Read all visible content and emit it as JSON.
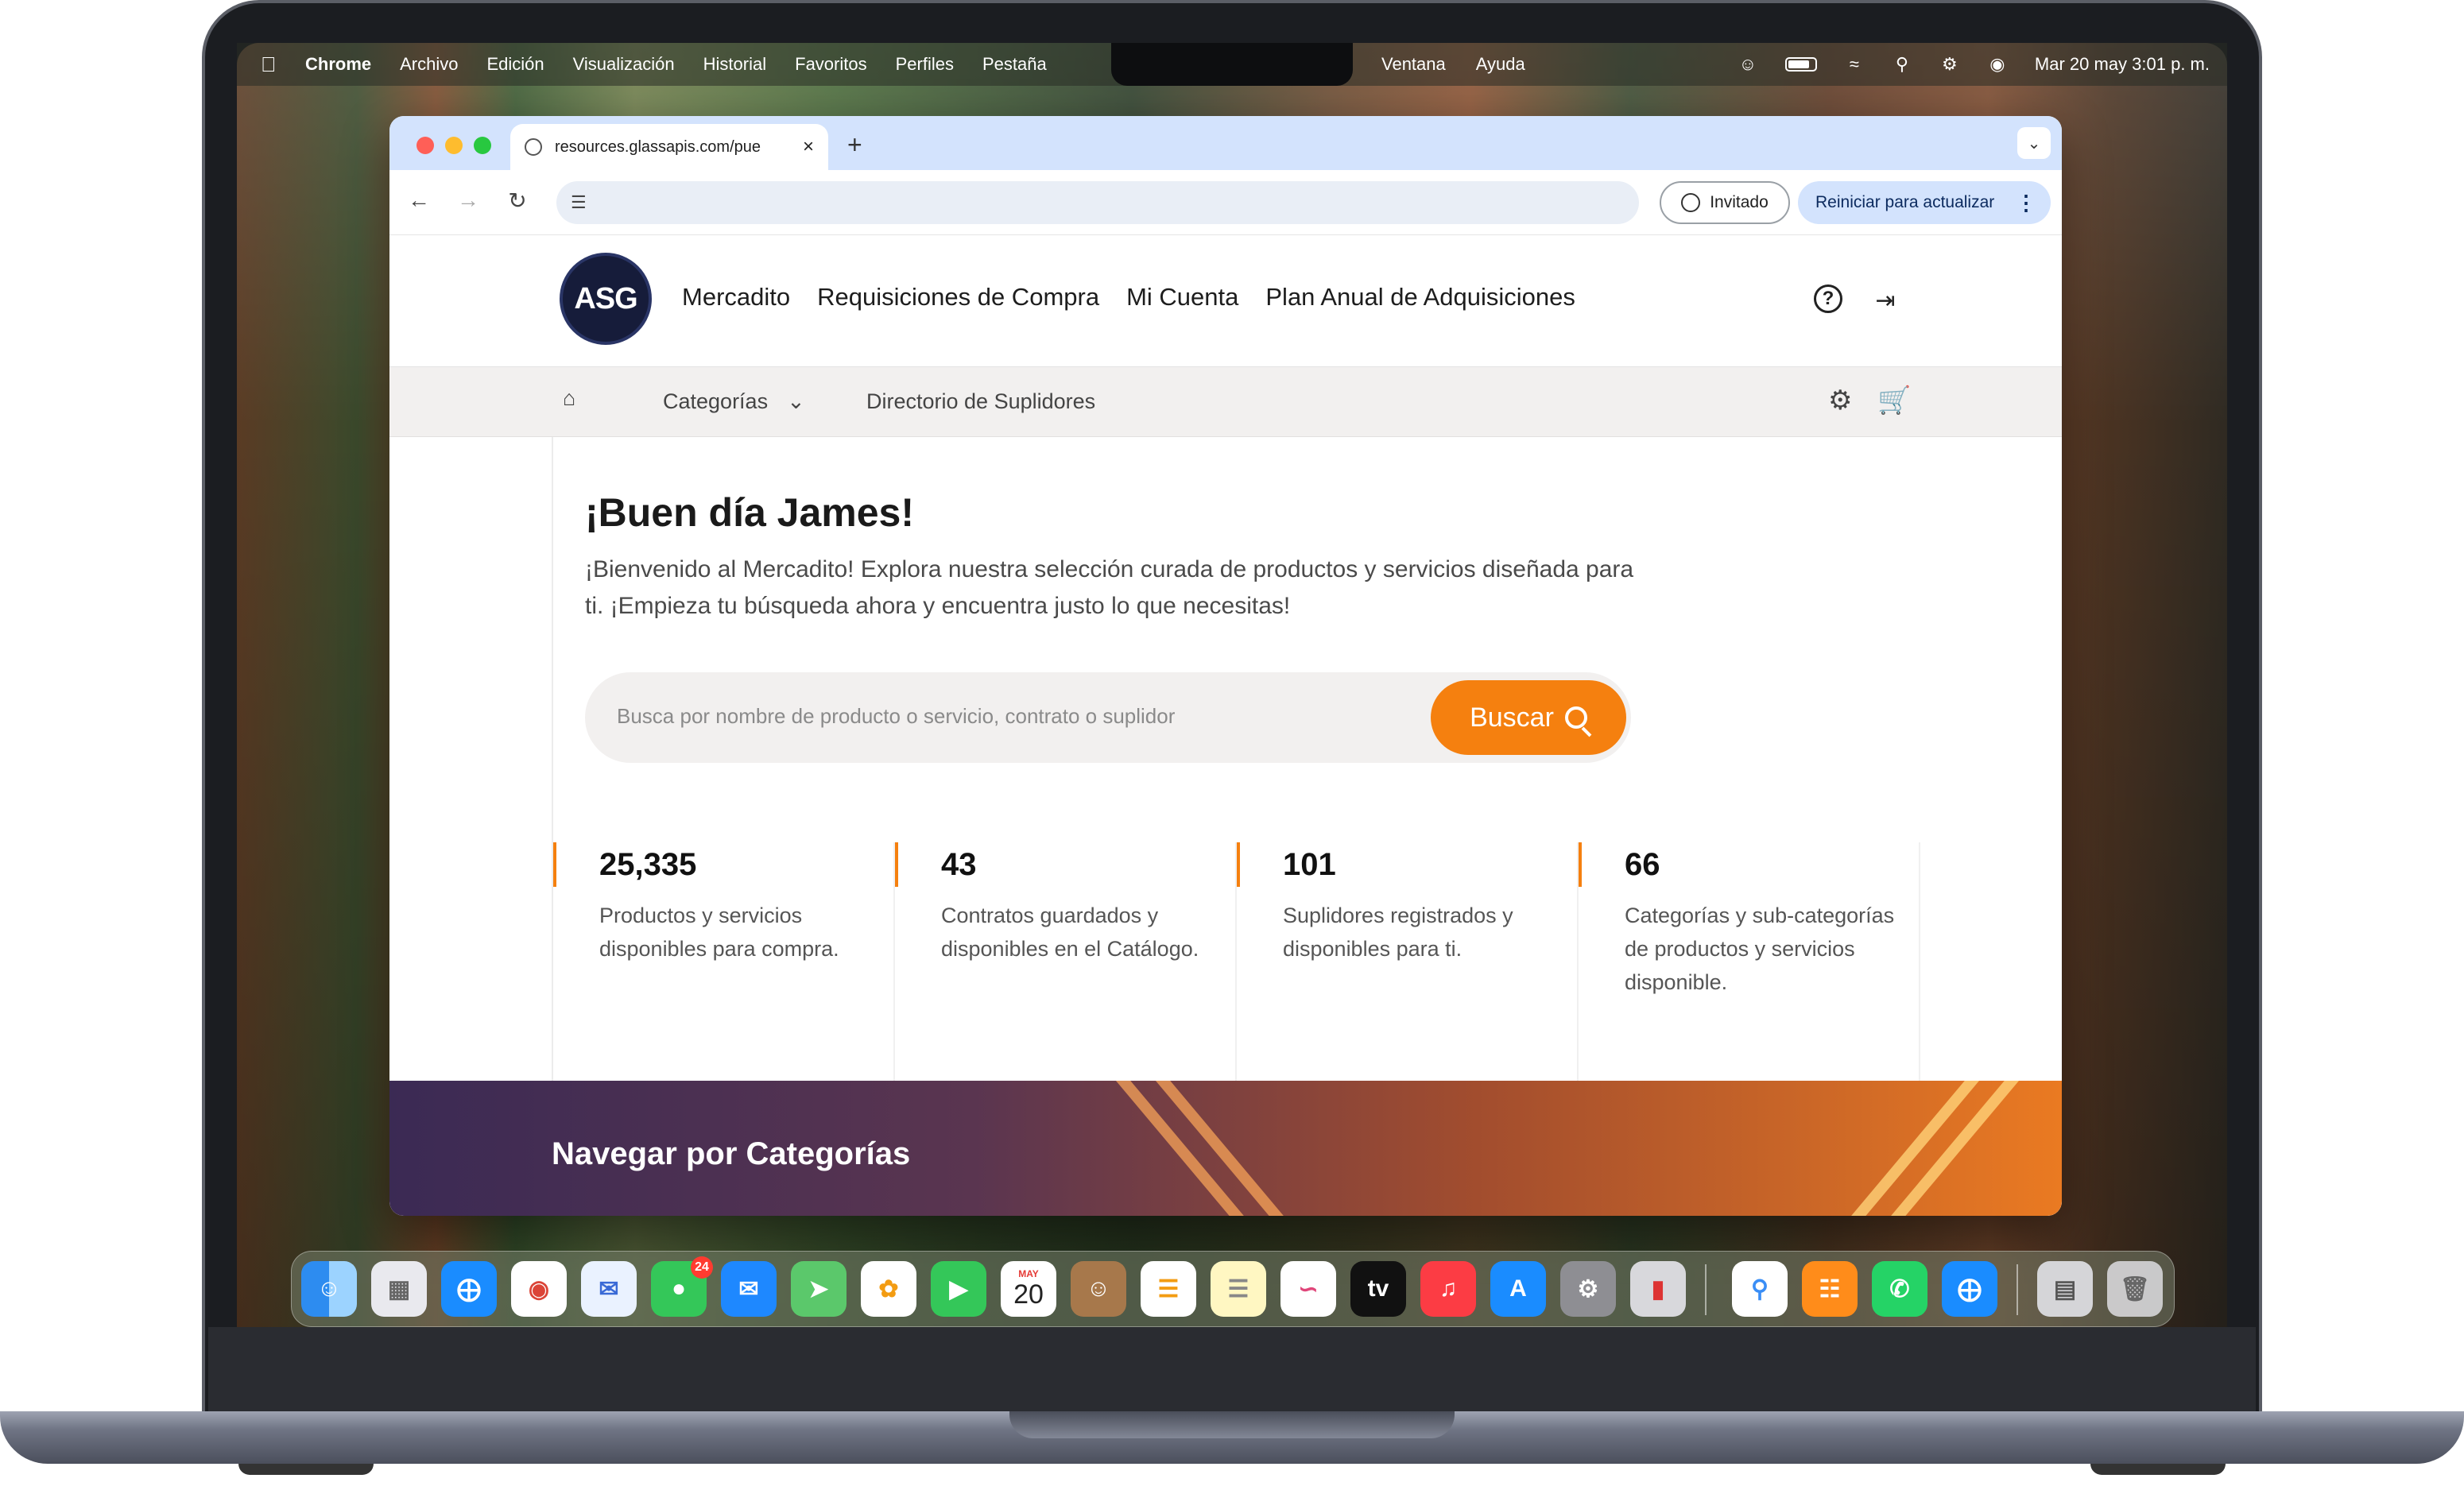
{
  "menubar": {
    "app": "Chrome",
    "items": [
      "Archivo",
      "Edición",
      "Visualización",
      "Historial",
      "Favoritos",
      "Perfiles",
      "Pestaña"
    ],
    "items_right": [
      "Ventana",
      "Ayuda"
    ],
    "datetime": "Mar 20 may  3:01 p. m."
  },
  "browser": {
    "tab_title": "resources.glassapis.com/pue",
    "guest_label": "Invitado",
    "relaunch_label": "Reiniciar para actualizar"
  },
  "site": {
    "logo_text": "ASG",
    "nav": [
      "Mercadito",
      "Requisiciones de Compra",
      "Mi Cuenta",
      "Plan Anual de Adquisiciones"
    ],
    "subnav": {
      "categories": "Categorías",
      "directory": "Directorio de Suplidores"
    },
    "greeting": "¡Buen día James!",
    "intro": "¡Bienvenido al Mercadito! Explora nuestra selección curada de productos y servicios diseñada para ti. ¡Empieza tu búsqueda ahora y encuentra justo lo que necesitas!",
    "search": {
      "placeholder": "Busca por nombre de producto o servicio, contrato o suplidor",
      "button": "Buscar"
    },
    "stats": [
      {
        "value": "25,335",
        "desc": "Productos y servicios disponibles para compra."
      },
      {
        "value": "43",
        "desc": "Contratos guardados y disponibles en el Catálogo."
      },
      {
        "value": "101",
        "desc": "Suplidores registrados y disponibles para ti."
      },
      {
        "value": "66",
        "desc": "Categorías y sub-categorías de productos y servicios disponible."
      }
    ],
    "categories_title": "Navegar por Categorías",
    "accent_color": "#f5800f"
  },
  "dock": {
    "messages_badge": "24",
    "calendar_month": "MAY",
    "calendar_day": "20",
    "tv_label": "tv"
  }
}
